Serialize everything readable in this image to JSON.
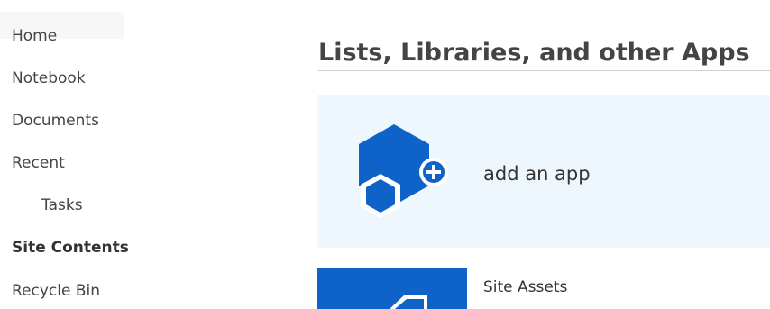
{
  "sidebar": {
    "items": [
      {
        "label": "Home",
        "active": false
      },
      {
        "label": "Notebook",
        "active": false
      },
      {
        "label": "Documents",
        "active": false
      },
      {
        "label": "Recent",
        "active": false
      },
      {
        "label": "Tasks",
        "active": false
      },
      {
        "label": "Site Contents",
        "active": true
      },
      {
        "label": "Recycle Bin",
        "active": false
      }
    ]
  },
  "main": {
    "title": "Lists, Libraries, and other Apps",
    "add_app": {
      "label": "add an app",
      "icon": "add-app-hexagon-icon"
    },
    "apps": [
      {
        "name": "Site Assets",
        "icon": "document-library-icon"
      }
    ]
  },
  "colors": {
    "accent_blue": "#0f62c7",
    "tile_background": "#eef7fd",
    "text": "#333333"
  }
}
